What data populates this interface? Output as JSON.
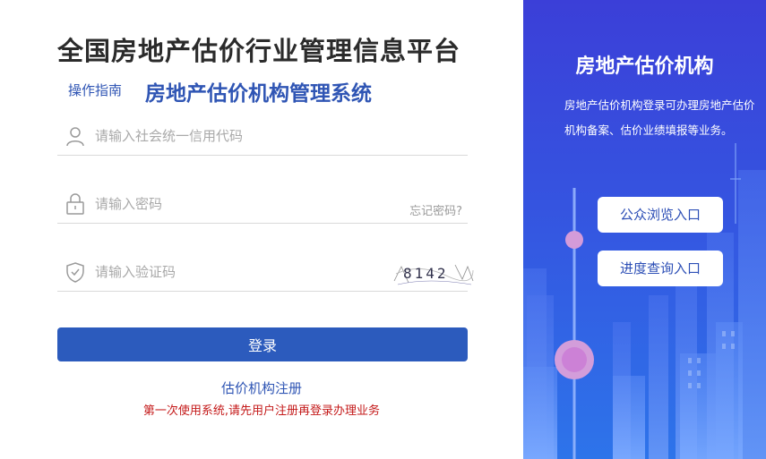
{
  "header": {
    "title": "全国房地产估价行业管理信息平台",
    "guide_link": "操作指南",
    "subtitle": "房地产估价机构管理系统"
  },
  "form": {
    "credit_code": {
      "placeholder": "请输入社会统一信用代码",
      "value": ""
    },
    "password": {
      "placeholder": "请输入密码",
      "value": ""
    },
    "forgot_password": "忘记密码?",
    "captcha_input": {
      "placeholder": "请输入验证码",
      "value": ""
    },
    "captcha_text": "8142",
    "login_label": "登录",
    "register_link": "估价机构注册",
    "notice": "第一次使用系统,请先用户注册再登录办理业务"
  },
  "panel": {
    "title": "房地产估价机构",
    "description": "房地产估价机构登录可办理房地产估价机构备案、估价业绩填报等业务。",
    "public_browse": "公众浏览入口",
    "progress_query": "进度查询入口"
  },
  "colors": {
    "brand_blue": "#2c5bbd",
    "link_blue": "#2f55b4",
    "notice_red": "#c41a1a",
    "panel_top": "#3b3fd8",
    "panel_bottom": "#2d74ea"
  },
  "icons": {
    "credit_code": "user-icon",
    "password": "lock-icon",
    "captcha": "shield-check-icon"
  }
}
